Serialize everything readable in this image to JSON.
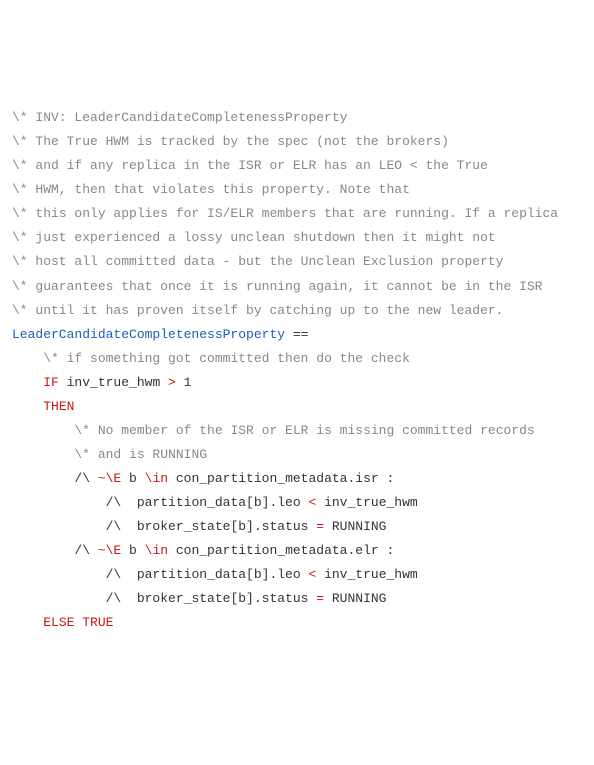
{
  "lines": {
    "c1": "\\* INV: LeaderCandidateCompletenessProperty",
    "c2": "\\* The True HWM is tracked by the spec (not the brokers)",
    "c3": "\\* and if any replica in the ISR or ELR has an LEO < the True",
    "c4": "\\* HWM, then that violates this property. Note that",
    "c5": "\\* this only applies for IS/ELR members that are running. If a replica",
    "c6": "\\* just experienced a lossy unclean shutdown then it might not",
    "c7": "\\* host all committed data - but the Unclean Exclusion property",
    "c8": "\\* guarantees that once it is running again, it cannot be in the ISR",
    "c9": "\\* until it has proven itself by catching up to the new leader.",
    "defName": "LeaderCandidateCompletenessProperty",
    "eqeq": " ==",
    "c10": "\\* if something got committed then do the check",
    "kwIF": "IF",
    "condVar": " inv_true_hwm ",
    "condOp": ">",
    "condNum": " 1",
    "kwTHEN": "THEN",
    "c11": "\\* No member of the ISR or ELR is missing committed records",
    "c12": "\\* and is RUNNING",
    "conj": "/\\ ",
    "notExists": "~\\E",
    "bvar": " b ",
    "inKw": "\\in",
    "isrExpr": " con_partition_metadata.isr :",
    "leoExpr": " partition_data[b].leo ",
    "ltOp": "<",
    "trueHwm": " inv_true_hwm",
    "statusExpr": " broker_state[b].status ",
    "eqOp": "=",
    "running": " RUNNING",
    "elrExpr": " con_partition_metadata.elr :",
    "kwELSE": "ELSE",
    "kwTRUE": " TRUE"
  },
  "indent": {
    "i1": "    ",
    "i2": "        ",
    "i3": "            "
  }
}
